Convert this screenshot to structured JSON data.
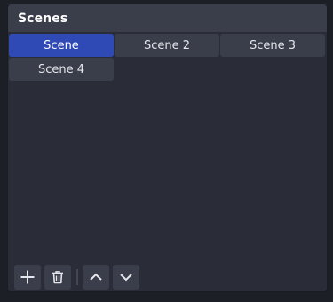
{
  "panel": {
    "title": "Scenes"
  },
  "scenes": [
    {
      "label": "Scene",
      "active": true
    },
    {
      "label": "Scene 2",
      "active": false
    },
    {
      "label": "Scene 3",
      "active": false
    },
    {
      "label": "Scene 4",
      "active": false
    }
  ],
  "toolbar": {
    "buttons": [
      {
        "icon": "plus-icon"
      },
      {
        "icon": "trash-icon"
      },
      {
        "icon": "chevron-up-icon"
      },
      {
        "icon": "chevron-down-icon"
      }
    ]
  },
  "colors": {
    "background": "#1d1f26",
    "panel": "#2a2d37",
    "header": "#3a3d4a",
    "active_scene": "#2f4ab5"
  }
}
